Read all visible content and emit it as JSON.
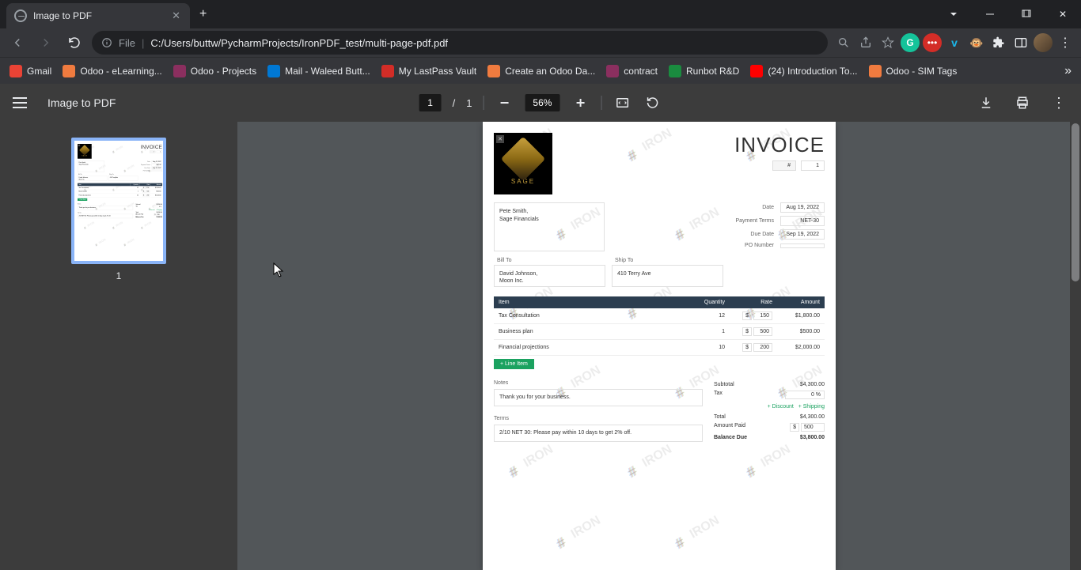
{
  "browser": {
    "tab_title": "Image to PDF",
    "url_prefix": "File",
    "url_path": "C:/Users/buttw/PycharmProjects/IronPDF_test/multi-page-pdf.pdf"
  },
  "bookmarks": [
    {
      "label": "Gmail",
      "color": "#EA4335"
    },
    {
      "label": "Odoo - eLearning...",
      "color": "#F07B3F"
    },
    {
      "label": "Odoo - Projects",
      "color": "#8B2F5F"
    },
    {
      "label": "Mail - Waleed Butt...",
      "color": "#0078D4"
    },
    {
      "label": "My LastPass Vault",
      "color": "#D32D27"
    },
    {
      "label": "Create an Odoo Da...",
      "color": "#F07B3F"
    },
    {
      "label": "contract",
      "color": "#8B2F5F"
    },
    {
      "label": "Runbot R&D",
      "color": "#1A8C3F"
    },
    {
      "label": "(24) Introduction To...",
      "color": "#FF0000"
    },
    {
      "label": "Odoo - SIM Tags",
      "color": "#F07B3F"
    }
  ],
  "pdf": {
    "title": "Image to PDF",
    "current_page": "1",
    "total_pages": "1",
    "page_sep": "/",
    "zoom": "56%",
    "thumb_label": "1"
  },
  "invoice": {
    "title": "INVOICE",
    "number_hash": "#",
    "number_value": "1",
    "logo_name": "SAGE",
    "from_name": "Pete Smith,",
    "from_company": "Sage Financials",
    "meta": {
      "date_label": "Date",
      "date_value": "Aug 19, 2022",
      "terms_label": "Payment Terms",
      "terms_value": "NET-30",
      "due_label": "Due Date",
      "due_value": "Sep 19, 2022",
      "po_label": "PO Number",
      "po_value": ""
    },
    "billto_label": "Bill To",
    "shipto_label": "Ship To",
    "billto_name": "David Johnson,",
    "billto_company": "Moon Inc.",
    "shipto_addr": "410 Terry Ave",
    "columns": {
      "item": "Item",
      "qty": "Quantity",
      "rate": "Rate",
      "amount": "Amount"
    },
    "lines": [
      {
        "item": "Tax Consultation",
        "qty": "12",
        "curr": "$",
        "rate": "150",
        "amount": "$1,800.00"
      },
      {
        "item": "Business plan",
        "qty": "1",
        "curr": "$",
        "rate": "500",
        "amount": "$500.00"
      },
      {
        "item": "Financial projections",
        "qty": "10",
        "curr": "$",
        "rate": "200",
        "amount": "$2,000.00"
      }
    ],
    "line_btn": "+ Line Item",
    "notes_label": "Notes",
    "notes_text": "Thank you for your business.",
    "terms_label_box": "Terms",
    "terms_text": "2/10 NET 30: Please pay within 10 days to get 2% off.",
    "summary": {
      "subtotal_label": "Subtotal",
      "subtotal_value": "$4,300.00",
      "tax_label": "Tax",
      "tax_value": "0 %",
      "discount_link": "+ Discount",
      "shipping_link": "+ Shipping",
      "total_label": "Total",
      "total_value": "$4,300.00",
      "paid_label": "Amount Paid",
      "paid_curr": "$",
      "paid_value": "500",
      "balance_label": "Balance Due",
      "balance_value": "$3,800.00"
    }
  }
}
